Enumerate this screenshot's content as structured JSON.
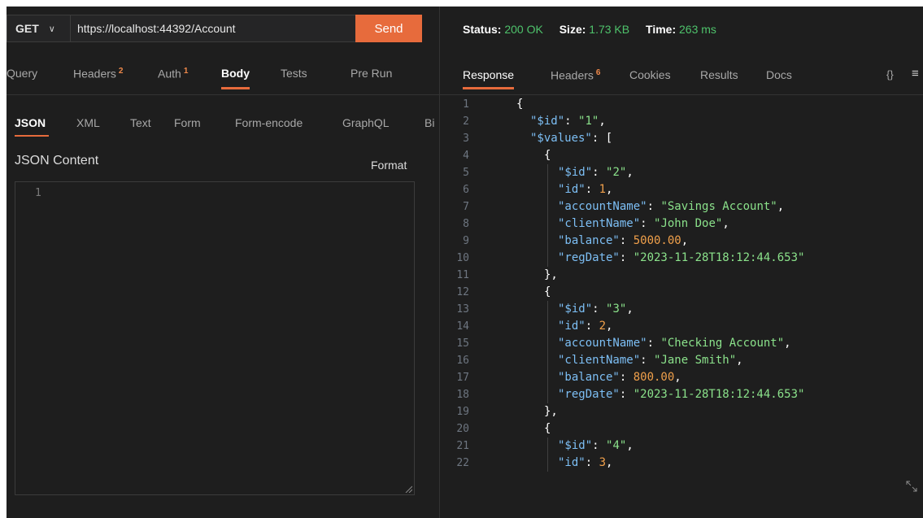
{
  "request": {
    "method": "GET",
    "url": "https://localhost:44392/Account",
    "send_label": "Send",
    "tabs": [
      {
        "label": "Query",
        "badge": ""
      },
      {
        "label": "Headers",
        "badge": "2"
      },
      {
        "label": "Auth",
        "badge": "1"
      },
      {
        "label": "Body",
        "badge": ""
      },
      {
        "label": "Tests",
        "badge": ""
      },
      {
        "label": "Pre Run",
        "badge": ""
      }
    ],
    "body_tabs": [
      "JSON",
      "XML",
      "Text",
      "Form",
      "Form-encode",
      "GraphQL",
      "Bi"
    ],
    "json_content_label": "JSON Content",
    "format_label": "Format",
    "editor_line": "1"
  },
  "response": {
    "status_label": "Status:",
    "status_value": "200 OK",
    "size_label": "Size:",
    "size_value": "1.73 KB",
    "time_label": "Time:",
    "time_value": "263 ms",
    "tabs": [
      {
        "label": "Response",
        "badge": ""
      },
      {
        "label": "Headers",
        "badge": "6"
      },
      {
        "label": "Cookies",
        "badge": ""
      },
      {
        "label": "Results",
        "badge": ""
      },
      {
        "label": "Docs",
        "badge": ""
      }
    ],
    "braces_icon": "{}",
    "menu_icon": "≡",
    "lines": [
      {
        "n": "1",
        "indent": 0,
        "parts": [
          {
            "c": "p",
            "t": "{"
          }
        ]
      },
      {
        "n": "2",
        "indent": 1,
        "parts": [
          {
            "c": "k",
            "t": "\"$id\""
          },
          {
            "c": "p",
            "t": ": "
          },
          {
            "c": "s",
            "t": "\"1\""
          },
          {
            "c": "p",
            "t": ","
          }
        ]
      },
      {
        "n": "3",
        "indent": 1,
        "parts": [
          {
            "c": "k",
            "t": "\"$values\""
          },
          {
            "c": "p",
            "t": ": ["
          }
        ]
      },
      {
        "n": "4",
        "indent": 2,
        "parts": [
          {
            "c": "p",
            "t": "{"
          }
        ]
      },
      {
        "n": "5",
        "indent": 3,
        "parts": [
          {
            "c": "k",
            "t": "\"$id\""
          },
          {
            "c": "p",
            "t": ": "
          },
          {
            "c": "s",
            "t": "\"2\""
          },
          {
            "c": "p",
            "t": ","
          }
        ]
      },
      {
        "n": "6",
        "indent": 3,
        "parts": [
          {
            "c": "k",
            "t": "\"id\""
          },
          {
            "c": "p",
            "t": ": "
          },
          {
            "c": "n",
            "t": "1"
          },
          {
            "c": "p",
            "t": ","
          }
        ]
      },
      {
        "n": "7",
        "indent": 3,
        "parts": [
          {
            "c": "k",
            "t": "\"accountName\""
          },
          {
            "c": "p",
            "t": ": "
          },
          {
            "c": "s",
            "t": "\"Savings Account\""
          },
          {
            "c": "p",
            "t": ","
          }
        ]
      },
      {
        "n": "8",
        "indent": 3,
        "parts": [
          {
            "c": "k",
            "t": "\"clientName\""
          },
          {
            "c": "p",
            "t": ": "
          },
          {
            "c": "s",
            "t": "\"John Doe\""
          },
          {
            "c": "p",
            "t": ","
          }
        ]
      },
      {
        "n": "9",
        "indent": 3,
        "parts": [
          {
            "c": "k",
            "t": "\"balance\""
          },
          {
            "c": "p",
            "t": ": "
          },
          {
            "c": "n",
            "t": "5000.00"
          },
          {
            "c": "p",
            "t": ","
          }
        ]
      },
      {
        "n": "10",
        "indent": 3,
        "parts": [
          {
            "c": "k",
            "t": "\"regDate\""
          },
          {
            "c": "p",
            "t": ": "
          },
          {
            "c": "s",
            "t": "\"2023-11-28T18:12:44.653\""
          }
        ]
      },
      {
        "n": "11",
        "indent": 2,
        "parts": [
          {
            "c": "p",
            "t": "},"
          }
        ]
      },
      {
        "n": "12",
        "indent": 2,
        "parts": [
          {
            "c": "p",
            "t": "{"
          }
        ]
      },
      {
        "n": "13",
        "indent": 3,
        "parts": [
          {
            "c": "k",
            "t": "\"$id\""
          },
          {
            "c": "p",
            "t": ": "
          },
          {
            "c": "s",
            "t": "\"3\""
          },
          {
            "c": "p",
            "t": ","
          }
        ]
      },
      {
        "n": "14",
        "indent": 3,
        "parts": [
          {
            "c": "k",
            "t": "\"id\""
          },
          {
            "c": "p",
            "t": ": "
          },
          {
            "c": "n",
            "t": "2"
          },
          {
            "c": "p",
            "t": ","
          }
        ]
      },
      {
        "n": "15",
        "indent": 3,
        "parts": [
          {
            "c": "k",
            "t": "\"accountName\""
          },
          {
            "c": "p",
            "t": ": "
          },
          {
            "c": "s",
            "t": "\"Checking Account\""
          },
          {
            "c": "p",
            "t": ","
          }
        ]
      },
      {
        "n": "16",
        "indent": 3,
        "parts": [
          {
            "c": "k",
            "t": "\"clientName\""
          },
          {
            "c": "p",
            "t": ": "
          },
          {
            "c": "s",
            "t": "\"Jane Smith\""
          },
          {
            "c": "p",
            "t": ","
          }
        ]
      },
      {
        "n": "17",
        "indent": 3,
        "parts": [
          {
            "c": "k",
            "t": "\"balance\""
          },
          {
            "c": "p",
            "t": ": "
          },
          {
            "c": "n",
            "t": "800.00"
          },
          {
            "c": "p",
            "t": ","
          }
        ]
      },
      {
        "n": "18",
        "indent": 3,
        "parts": [
          {
            "c": "k",
            "t": "\"regDate\""
          },
          {
            "c": "p",
            "t": ": "
          },
          {
            "c": "s",
            "t": "\"2023-11-28T18:12:44.653\""
          }
        ]
      },
      {
        "n": "19",
        "indent": 2,
        "parts": [
          {
            "c": "p",
            "t": "},"
          }
        ]
      },
      {
        "n": "20",
        "indent": 2,
        "parts": [
          {
            "c": "p",
            "t": "{"
          }
        ]
      },
      {
        "n": "21",
        "indent": 3,
        "parts": [
          {
            "c": "k",
            "t": "\"$id\""
          },
          {
            "c": "p",
            "t": ": "
          },
          {
            "c": "s",
            "t": "\"4\""
          },
          {
            "c": "p",
            "t": ","
          }
        ]
      },
      {
        "n": "22",
        "indent": 3,
        "parts": [
          {
            "c": "k",
            "t": "\"id\""
          },
          {
            "c": "p",
            "t": ": "
          },
          {
            "c": "n",
            "t": "3"
          },
          {
            "c": "p",
            "t": ","
          }
        ]
      }
    ]
  },
  "colors": {
    "accent": "#e76b3c",
    "status_green": "#4ec26b",
    "json_key": "#7dbff5",
    "json_string": "#8be28b",
    "json_number": "#f0a04b",
    "background": "#1e1e1e"
  }
}
